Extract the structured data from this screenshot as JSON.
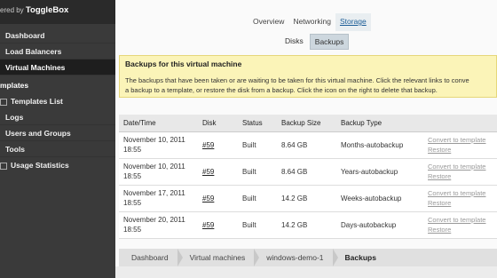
{
  "brand": {
    "prefix": "ered by",
    "name": "ToggleBox"
  },
  "sidebar": {
    "items": [
      {
        "label": "Dashboard"
      },
      {
        "label": "Load Balancers"
      },
      {
        "label": "Virtual Machines"
      }
    ],
    "templates_group": "mplates",
    "templates_list": "Templates List",
    "items2": [
      {
        "label": "Logs"
      },
      {
        "label": "Users and Groups"
      },
      {
        "label": "Tools"
      }
    ],
    "usage": "Usage Statistics"
  },
  "tabs": {
    "top": [
      "Overview",
      "Networking",
      "Storage"
    ],
    "sub": [
      "Disks",
      "Backups"
    ]
  },
  "notice": {
    "title": "Backups for this virtual machine",
    "line1": "The backups that have been taken or are waiting to be taken for this virtual machine. Click the relevant links to conve",
    "line2": "a backup to a template, or restore the disk from a backup. Click the icon on the right to delete that backup."
  },
  "table": {
    "headers": [
      "Date/Time",
      "Disk",
      "Status",
      "Backup Size",
      "Backup Type",
      ""
    ],
    "rows": [
      {
        "date": "November 10, 2011",
        "time": "18:55",
        "disk": "#59",
        "status": "Built",
        "size": "8.64 GB",
        "type": "Months-autobackup",
        "convert": "Convert to template",
        "restore": "Restore"
      },
      {
        "date": "November 10, 2011",
        "time": "18:55",
        "disk": "#59",
        "status": "Built",
        "size": "8.64 GB",
        "type": "Years-autobackup",
        "convert": "Convert to template",
        "restore": "Restore"
      },
      {
        "date": "November 17, 2011",
        "time": "18:55",
        "disk": "#59",
        "status": "Built",
        "size": "14.2 GB",
        "type": "Weeks-autobackup",
        "convert": "Convert to template",
        "restore": "Restore"
      },
      {
        "date": "November 20, 2011",
        "time": "18:55",
        "disk": "#59",
        "status": "Built",
        "size": "14.2 GB",
        "type": "Days-autobackup",
        "convert": "Convert to template",
        "restore": "Restore"
      }
    ]
  },
  "breadcrumb": [
    "Dashboard",
    "Virtual machines",
    "windows-demo-1",
    "Backups"
  ]
}
